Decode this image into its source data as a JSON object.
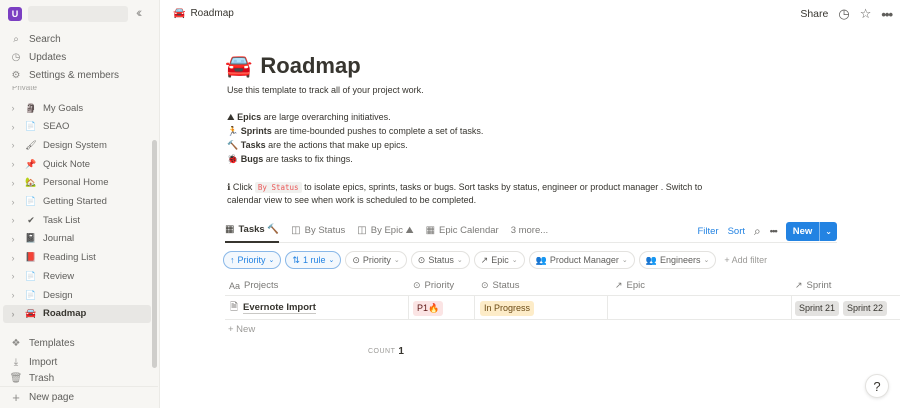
{
  "workspace": {
    "avatar": "U"
  },
  "sidebar": {
    "top": [
      {
        "icon": "search-icon",
        "glyph": "🔍",
        "label": "Search"
      },
      {
        "icon": "clock-icon",
        "glyph": "◷",
        "label": "Updates"
      },
      {
        "icon": "gear-icon",
        "glyph": "⚙",
        "label": "Settings & members"
      }
    ],
    "section_label": "Private",
    "pages": [
      {
        "emoji": "🗿",
        "label": "My Goals"
      },
      {
        "emoji": "📄",
        "label": "SEAO"
      },
      {
        "emoji": "🖌",
        "label": "Design System"
      },
      {
        "emoji": "📌",
        "label": "Quick Note"
      },
      {
        "emoji": "🏡",
        "label": "Personal Home"
      },
      {
        "emoji": "📄",
        "label": "Getting Started"
      },
      {
        "emoji": "✔",
        "label": "Task List"
      },
      {
        "emoji": "📓",
        "label": "Journal"
      },
      {
        "emoji": "📕",
        "label": "Reading List"
      },
      {
        "emoji": "📄",
        "label": "Review"
      },
      {
        "emoji": "📄",
        "label": "Design"
      },
      {
        "emoji": "🚘",
        "label": "Roadmap"
      }
    ],
    "bottom": [
      {
        "icon": "templates-icon",
        "glyph": "❖",
        "label": "Templates"
      },
      {
        "icon": "import-icon",
        "glyph": "⤓",
        "label": "Import"
      },
      {
        "icon": "trash-icon",
        "glyph": "🗑",
        "label": "Trash"
      }
    ],
    "new_page": "New page"
  },
  "topbar": {
    "breadcrumb": "Roadmap",
    "share": "Share"
  },
  "page": {
    "emoji": "🚘",
    "title": "Roadmap",
    "intro": "Use this template to track all of your project work.",
    "bullets": [
      {
        "emoji": "⛰",
        "bold": "Epics",
        "text": " are large overarching initiatives."
      },
      {
        "emoji": "🏃",
        "bold": "Sprints",
        "text": " are time-bounded pushes to complete a set of tasks."
      },
      {
        "emoji": "🔨",
        "bold": "Tasks",
        "text": " are the actions that make up epics."
      },
      {
        "emoji": "🐞",
        "bold": "Bugs",
        "text": " are tasks to fix things."
      }
    ],
    "tip_emoji": "ℹ",
    "tip_pre": " Click ",
    "tip_code": "By Status",
    "tip_post": " to isolate epics, sprints, tasks or bugs. Sort tasks by status, engineer or product manager . Switch to",
    "tip_line2": "calendar view to see when work is scheduled to be completed."
  },
  "views": {
    "tabs": [
      {
        "icon": "table-icon",
        "glyph": "▦",
        "label": "Tasks 🔨"
      },
      {
        "icon": "board-icon",
        "glyph": "◫",
        "label": "By Status"
      },
      {
        "icon": "board-icon",
        "glyph": "◫",
        "label": "By Epic ⛰"
      },
      {
        "icon": "calendar-icon",
        "glyph": "▦",
        "label": "Epic Calendar"
      }
    ],
    "more": "3 more...",
    "filter": "Filter",
    "sort": "Sort",
    "new": "New"
  },
  "filters": {
    "chips": [
      {
        "glyph": "↑",
        "label": "Priority",
        "blue": true
      },
      {
        "glyph": "⇅",
        "label": "1 rule",
        "blue": true
      },
      {
        "glyph": "⊙",
        "label": "Priority",
        "blue": false
      },
      {
        "glyph": "⊙",
        "label": "Status",
        "blue": false
      },
      {
        "glyph": "↗",
        "label": "Epic",
        "blue": false
      },
      {
        "glyph": "👥",
        "label": "Product Manager",
        "blue": false
      },
      {
        "glyph": "👥",
        "label": "Engineers",
        "blue": false
      }
    ],
    "add": "+ Add filter"
  },
  "table": {
    "headers": [
      "Projects",
      "Priority",
      "Status",
      "Epic",
      "Sprint"
    ],
    "rows": [
      {
        "project": "Evernote Import",
        "priority": "P1🔥",
        "status": "In Progress",
        "epic": "",
        "sprints": [
          "Sprint 21",
          "Sprint 22"
        ]
      }
    ],
    "new_row": "+ New",
    "count_label": "COUNT",
    "count": "1"
  },
  "colors": {
    "accent": "#2383e2",
    "priority_tag": "#fbe4e4",
    "status_tag": "#fdecc8",
    "sprint_tag": "#e3e2e0",
    "active_page": "#e8e7e4"
  }
}
